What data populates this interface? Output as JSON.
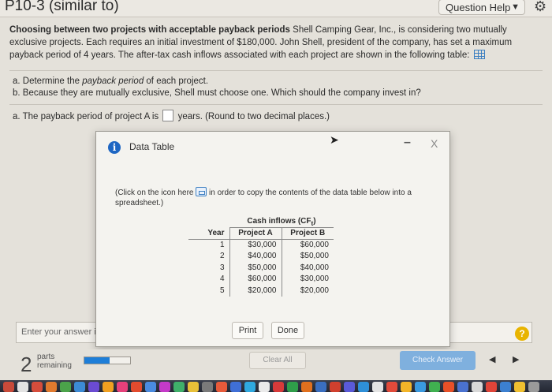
{
  "header": {
    "title": "P10-3 (similar to)",
    "question_help": "Question Help",
    "question_help_caret": "▼",
    "gear_glyph": "⚙"
  },
  "problem": {
    "lead": "Choosing between two projects with acceptable payback periods",
    "body": " Shell Camping Gear, Inc., is considering two mutually exclusive projects. Each requires an initial investment of $180,000. John Shell, president of the company, has set a maximum payback period of 4 years. The after-tax cash inflows associated with each project are shown in the following table:",
    "table_icon": "table-grid-icon"
  },
  "parts": {
    "a": "a. Determine the ",
    "a_em": "payback period",
    "a_tail": " of each project.",
    "b": "b. Because they are mutually exclusive, Shell must choose one. Which should the company invest in?"
  },
  "question": {
    "prefix": "a. The payback period of project A is",
    "suffix": "years.  (Round to two decimal places.)"
  },
  "modal": {
    "info_glyph": "i",
    "title": "Data Table",
    "minimize_glyph": "–",
    "close_glyph": "X",
    "cursor_glyph": "➤",
    "hint_prefix": "(Click on the icon here",
    "hint_suffix": " in order to copy the contents of the data table below into a spreadsheet.)",
    "table": {
      "group_header": "Cash inflows (CF",
      "group_header_sub": "t",
      "group_header_close": ")",
      "columns": [
        "Year",
        "Project A",
        "Project B"
      ],
      "rows": [
        [
          "1",
          "$30,000",
          "$60,000"
        ],
        [
          "2",
          "$40,000",
          "$50,000"
        ],
        [
          "3",
          "$50,000",
          "$40,000"
        ],
        [
          "4",
          "$60,000",
          "$30,000"
        ],
        [
          "5",
          "$20,000",
          "$20,000"
        ]
      ]
    },
    "print_label": "Print",
    "done_label": "Done"
  },
  "answer": {
    "placeholder": "Enter your answer i",
    "help_glyph": "?"
  },
  "footer": {
    "parts_count": "2",
    "parts_label_1": "parts",
    "parts_label_2": "remaining",
    "progress_fraction": 0.55,
    "clear_all": "Clear All",
    "check_answer": "Check Answer",
    "prev_glyph": "◀",
    "next_glyph": "▶"
  },
  "colors": {
    "accent_blue": "#1e7ed8",
    "check_answer_bg": "#7fb0de",
    "help_yellow": "#e8b400"
  }
}
